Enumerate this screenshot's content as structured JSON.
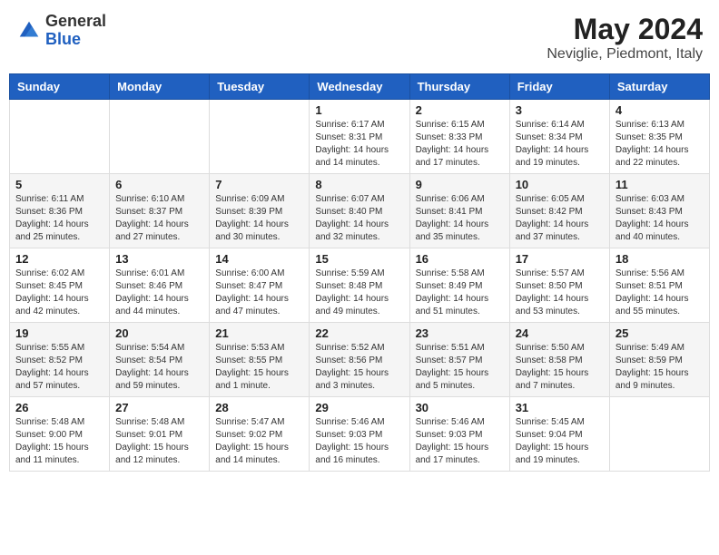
{
  "header": {
    "logo_general": "General",
    "logo_blue": "Blue",
    "month_year": "May 2024",
    "location": "Neviglie, Piedmont, Italy"
  },
  "weekdays": [
    "Sunday",
    "Monday",
    "Tuesday",
    "Wednesday",
    "Thursday",
    "Friday",
    "Saturday"
  ],
  "weeks": [
    [
      {
        "day": "",
        "sunrise": "",
        "sunset": "",
        "daylight": ""
      },
      {
        "day": "",
        "sunrise": "",
        "sunset": "",
        "daylight": ""
      },
      {
        "day": "",
        "sunrise": "",
        "sunset": "",
        "daylight": ""
      },
      {
        "day": "1",
        "sunrise": "Sunrise: 6:17 AM",
        "sunset": "Sunset: 8:31 PM",
        "daylight": "Daylight: 14 hours and 14 minutes."
      },
      {
        "day": "2",
        "sunrise": "Sunrise: 6:15 AM",
        "sunset": "Sunset: 8:33 PM",
        "daylight": "Daylight: 14 hours and 17 minutes."
      },
      {
        "day": "3",
        "sunrise": "Sunrise: 6:14 AM",
        "sunset": "Sunset: 8:34 PM",
        "daylight": "Daylight: 14 hours and 19 minutes."
      },
      {
        "day": "4",
        "sunrise": "Sunrise: 6:13 AM",
        "sunset": "Sunset: 8:35 PM",
        "daylight": "Daylight: 14 hours and 22 minutes."
      }
    ],
    [
      {
        "day": "5",
        "sunrise": "Sunrise: 6:11 AM",
        "sunset": "Sunset: 8:36 PM",
        "daylight": "Daylight: 14 hours and 25 minutes."
      },
      {
        "day": "6",
        "sunrise": "Sunrise: 6:10 AM",
        "sunset": "Sunset: 8:37 PM",
        "daylight": "Daylight: 14 hours and 27 minutes."
      },
      {
        "day": "7",
        "sunrise": "Sunrise: 6:09 AM",
        "sunset": "Sunset: 8:39 PM",
        "daylight": "Daylight: 14 hours and 30 minutes."
      },
      {
        "day": "8",
        "sunrise": "Sunrise: 6:07 AM",
        "sunset": "Sunset: 8:40 PM",
        "daylight": "Daylight: 14 hours and 32 minutes."
      },
      {
        "day": "9",
        "sunrise": "Sunrise: 6:06 AM",
        "sunset": "Sunset: 8:41 PM",
        "daylight": "Daylight: 14 hours and 35 minutes."
      },
      {
        "day": "10",
        "sunrise": "Sunrise: 6:05 AM",
        "sunset": "Sunset: 8:42 PM",
        "daylight": "Daylight: 14 hours and 37 minutes."
      },
      {
        "day": "11",
        "sunrise": "Sunrise: 6:03 AM",
        "sunset": "Sunset: 8:43 PM",
        "daylight": "Daylight: 14 hours and 40 minutes."
      }
    ],
    [
      {
        "day": "12",
        "sunrise": "Sunrise: 6:02 AM",
        "sunset": "Sunset: 8:45 PM",
        "daylight": "Daylight: 14 hours and 42 minutes."
      },
      {
        "day": "13",
        "sunrise": "Sunrise: 6:01 AM",
        "sunset": "Sunset: 8:46 PM",
        "daylight": "Daylight: 14 hours and 44 minutes."
      },
      {
        "day": "14",
        "sunrise": "Sunrise: 6:00 AM",
        "sunset": "Sunset: 8:47 PM",
        "daylight": "Daylight: 14 hours and 47 minutes."
      },
      {
        "day": "15",
        "sunrise": "Sunrise: 5:59 AM",
        "sunset": "Sunset: 8:48 PM",
        "daylight": "Daylight: 14 hours and 49 minutes."
      },
      {
        "day": "16",
        "sunrise": "Sunrise: 5:58 AM",
        "sunset": "Sunset: 8:49 PM",
        "daylight": "Daylight: 14 hours and 51 minutes."
      },
      {
        "day": "17",
        "sunrise": "Sunrise: 5:57 AM",
        "sunset": "Sunset: 8:50 PM",
        "daylight": "Daylight: 14 hours and 53 minutes."
      },
      {
        "day": "18",
        "sunrise": "Sunrise: 5:56 AM",
        "sunset": "Sunset: 8:51 PM",
        "daylight": "Daylight: 14 hours and 55 minutes."
      }
    ],
    [
      {
        "day": "19",
        "sunrise": "Sunrise: 5:55 AM",
        "sunset": "Sunset: 8:52 PM",
        "daylight": "Daylight: 14 hours and 57 minutes."
      },
      {
        "day": "20",
        "sunrise": "Sunrise: 5:54 AM",
        "sunset": "Sunset: 8:54 PM",
        "daylight": "Daylight: 14 hours and 59 minutes."
      },
      {
        "day": "21",
        "sunrise": "Sunrise: 5:53 AM",
        "sunset": "Sunset: 8:55 PM",
        "daylight": "Daylight: 15 hours and 1 minute."
      },
      {
        "day": "22",
        "sunrise": "Sunrise: 5:52 AM",
        "sunset": "Sunset: 8:56 PM",
        "daylight": "Daylight: 15 hours and 3 minutes."
      },
      {
        "day": "23",
        "sunrise": "Sunrise: 5:51 AM",
        "sunset": "Sunset: 8:57 PM",
        "daylight": "Daylight: 15 hours and 5 minutes."
      },
      {
        "day": "24",
        "sunrise": "Sunrise: 5:50 AM",
        "sunset": "Sunset: 8:58 PM",
        "daylight": "Daylight: 15 hours and 7 minutes."
      },
      {
        "day": "25",
        "sunrise": "Sunrise: 5:49 AM",
        "sunset": "Sunset: 8:59 PM",
        "daylight": "Daylight: 15 hours and 9 minutes."
      }
    ],
    [
      {
        "day": "26",
        "sunrise": "Sunrise: 5:48 AM",
        "sunset": "Sunset: 9:00 PM",
        "daylight": "Daylight: 15 hours and 11 minutes."
      },
      {
        "day": "27",
        "sunrise": "Sunrise: 5:48 AM",
        "sunset": "Sunset: 9:01 PM",
        "daylight": "Daylight: 15 hours and 12 minutes."
      },
      {
        "day": "28",
        "sunrise": "Sunrise: 5:47 AM",
        "sunset": "Sunset: 9:02 PM",
        "daylight": "Daylight: 15 hours and 14 minutes."
      },
      {
        "day": "29",
        "sunrise": "Sunrise: 5:46 AM",
        "sunset": "Sunset: 9:03 PM",
        "daylight": "Daylight: 15 hours and 16 minutes."
      },
      {
        "day": "30",
        "sunrise": "Sunrise: 5:46 AM",
        "sunset": "Sunset: 9:03 PM",
        "daylight": "Daylight: 15 hours and 17 minutes."
      },
      {
        "day": "31",
        "sunrise": "Sunrise: 5:45 AM",
        "sunset": "Sunset: 9:04 PM",
        "daylight": "Daylight: 15 hours and 19 minutes."
      },
      {
        "day": "",
        "sunrise": "",
        "sunset": "",
        "daylight": ""
      }
    ]
  ]
}
